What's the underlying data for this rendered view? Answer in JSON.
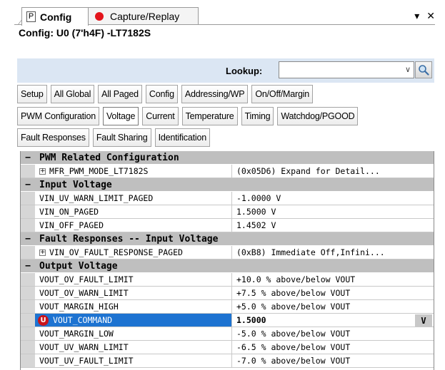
{
  "tabs": [
    {
      "icon": "P",
      "label": "Config"
    },
    {
      "label": "Capture/Replay"
    }
  ],
  "window_controls": {
    "dropdown": "▾",
    "close": "✕"
  },
  "config_title": "Config: U0 (7'h4F) -LT7182S",
  "lookup": {
    "label": "Lookup:",
    "value": ""
  },
  "category_rows": [
    [
      "Setup",
      "All Global",
      "All Paged",
      "Config",
      "Addressing/WP",
      "On/Off/Margin"
    ],
    [
      "PWM Configuration",
      "Voltage",
      "Current",
      "Temperature",
      "Timing",
      "Watchdog/PGOOD"
    ],
    [
      "Fault Responses",
      "Fault Sharing",
      "Identification"
    ]
  ],
  "active_category": "Voltage",
  "grid": {
    "sections": [
      {
        "title": "PWM Related Configuration",
        "items": [
          {
            "name": "MFR_PWM_MODE_LT7182S",
            "value": "(0x05D6) Expand for Detail...",
            "expandable": true
          }
        ]
      },
      {
        "title": "Input Voltage",
        "items": [
          {
            "name": "VIN_UV_WARN_LIMIT_PAGED",
            "value": "-1.0000 V"
          },
          {
            "name": "VIN_ON_PAGED",
            "value": "1.5000 V"
          },
          {
            "name": "VIN_OFF_PAGED",
            "value": "1.4502 V"
          }
        ]
      },
      {
        "title": "Fault Responses -- Input Voltage",
        "items": [
          {
            "name": "VIN_OV_FAULT_RESPONSE_PAGED",
            "value": "(0xB8) Immediate Off,Infini...",
            "expandable": true
          }
        ]
      },
      {
        "title": "Output Voltage",
        "items": [
          {
            "name": "VOUT_OV_FAULT_LIMIT",
            "value": "+10.0 % above/below VOUT"
          },
          {
            "name": "VOUT_OV_WARN_LIMIT",
            "value": "+7.5 % above/below VOUT"
          },
          {
            "name": "VOUT_MARGIN_HIGH",
            "value": "+5.0 % above/below VOUT"
          },
          {
            "name": "VOUT_COMMAND",
            "value": "1.5000",
            "selected": true,
            "unit_badge": "V",
            "icon": "U"
          },
          {
            "name": "VOUT_MARGIN_LOW",
            "value": "-5.0 % above/below VOUT"
          },
          {
            "name": "VOUT_UV_WARN_LIMIT",
            "value": "-6.5 % above/below VOUT"
          },
          {
            "name": "VOUT_UV_FAULT_LIMIT",
            "value": "-7.0 % above/below VOUT"
          }
        ]
      }
    ]
  },
  "colors": {
    "selection": "#1d73d1",
    "category_header": "#bfbfbf",
    "lookup_bar": "#dbe6f3",
    "record_dot": "#e3141b"
  }
}
